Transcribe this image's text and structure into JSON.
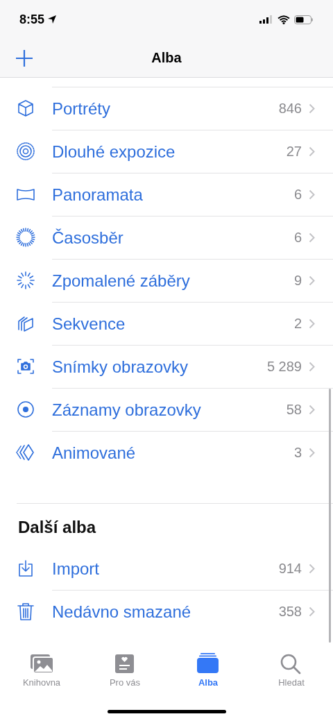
{
  "status_bar": {
    "time": "8:55"
  },
  "nav_bar": {
    "title": "Alba"
  },
  "media_types": [
    {
      "name": "Portréty",
      "count": "846"
    },
    {
      "name": "Dlouhé expozice",
      "count": "27"
    },
    {
      "name": "Panoramata",
      "count": "6"
    },
    {
      "name": "Časosběr",
      "count": "6"
    },
    {
      "name": "Zpomalené záběry",
      "count": "9"
    },
    {
      "name": "Sekvence",
      "count": "2"
    },
    {
      "name": "Snímky obrazovky",
      "count": "5 289"
    },
    {
      "name": "Záznamy obrazovky",
      "count": "58"
    },
    {
      "name": "Animované",
      "count": "3"
    }
  ],
  "other_albums": {
    "title": "Další alba",
    "items": [
      {
        "name": "Import",
        "count": "914"
      },
      {
        "name": "Nedávno smazané",
        "count": "358"
      }
    ]
  },
  "tab_bar": [
    {
      "label": "Knihovna",
      "selected": false
    },
    {
      "label": "Pro vás",
      "selected": false
    },
    {
      "label": "Alba",
      "selected": true
    },
    {
      "label": "Hledat",
      "selected": false
    }
  ]
}
